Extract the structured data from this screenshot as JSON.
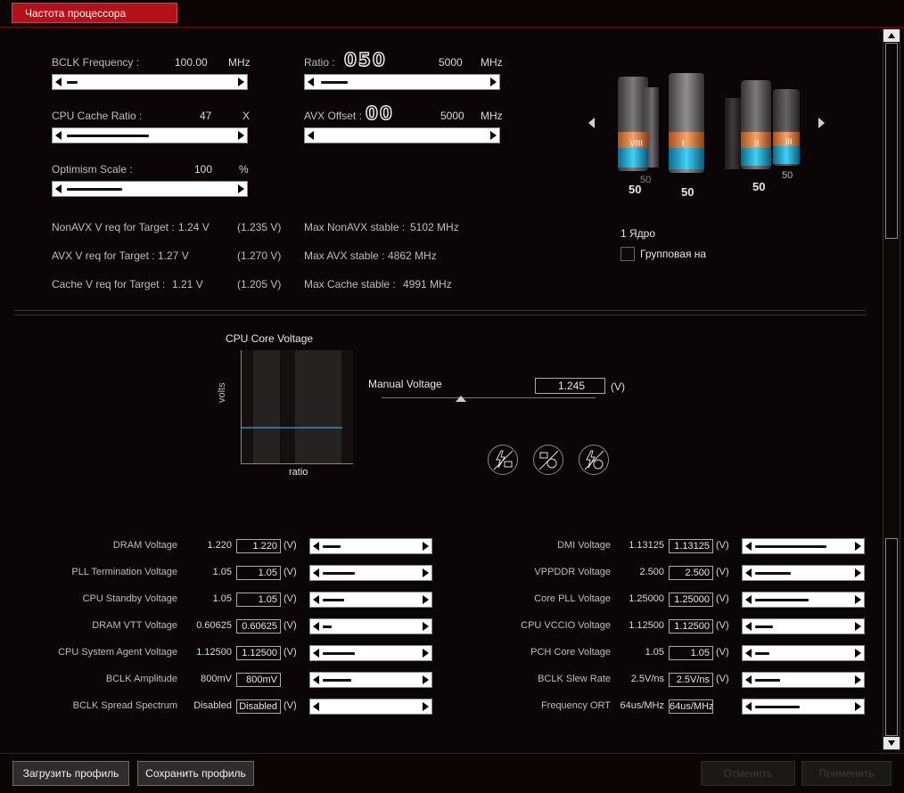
{
  "tab": {
    "label": "Частота процессора"
  },
  "top": {
    "bclk": {
      "label": "BCLK Frequency :",
      "value": "100.00",
      "unit": "MHz"
    },
    "cache_ratio": {
      "label": "CPU Cache Ratio :",
      "value": "47",
      "unit": "X"
    },
    "optimism": {
      "label": "Optimism Scale :",
      "value": "100",
      "unit": "%"
    },
    "ratio": {
      "label": "Ratio :",
      "digits": "050",
      "value": "5000",
      "unit": "MHz"
    },
    "avx_offset": {
      "label": "AVX Offset :",
      "digits": "00",
      "value": "5000",
      "unit": "MHz"
    }
  },
  "targets": [
    {
      "label": "NonAVX V req for Target :",
      "v": "1.24  V",
      "paren": "(1.235  V)",
      "max_label": "Max NonAVX stable :",
      "max_value": "5102  MHz"
    },
    {
      "label": "AVX V req for Target :",
      "v": "1.27  V",
      "paren": "(1.270  V)",
      "max_label": "Max AVX stable :",
      "max_value": "4862  MHz"
    },
    {
      "label": "Cache V req for Target :",
      "v": "1.21  V",
      "paren": "(1.205  V)",
      "max_label": "Max Cache stable :",
      "max_value": "4991  MHz"
    }
  ],
  "cores": {
    "numerals": [
      "VIII",
      "I",
      "II",
      "III"
    ],
    "values": [
      "50",
      "50",
      "50",
      "50",
      "50"
    ],
    "core_label": "1 Ядро",
    "group_label": "Групповая на"
  },
  "voltage": {
    "chart_title": "CPU Core Voltage",
    "y_axis": "volts",
    "x_axis": "ratio",
    "manual_label": "Manual Voltage",
    "manual_value": "1.245",
    "manual_unit": "(V)"
  },
  "mode_icons": [
    "power-save-icon",
    "fan-balance-icon",
    "power-fan-icon"
  ],
  "left_rows": [
    {
      "label": "DRAM Voltage",
      "value": "1.220",
      "input": "1.220",
      "unit": "(V)"
    },
    {
      "label": "PLL Termination Voltage",
      "value": "1.05",
      "input": "1.05",
      "unit": "(V)"
    },
    {
      "label": "CPU Standby Voltage",
      "value": "1.05",
      "input": "1.05",
      "unit": "(V)"
    },
    {
      "label": "DRAM VTT Voltage",
      "value": "0.60625",
      "input": "0.60625",
      "unit": "(V)"
    },
    {
      "label": "CPU System Agent Voltage",
      "value": "1.12500",
      "input": "1.12500",
      "unit": "(V)"
    },
    {
      "label": "BCLK Amplitude",
      "value": "800mV",
      "input": "800mV",
      "unit": ""
    },
    {
      "label": "BCLK Spread Spectrum",
      "value": "Disabled",
      "input": "Disabled",
      "unit": "(V)"
    }
  ],
  "right_rows": [
    {
      "label": "DMI Voltage",
      "value": "1.13125",
      "input": "1.13125",
      "unit": "(V)"
    },
    {
      "label": "VPPDDR Voltage",
      "value": "2.500",
      "input": "2.500",
      "unit": "(V)"
    },
    {
      "label": "Core PLL Voltage",
      "value": "1.25000",
      "input": "1.25000",
      "unit": "(V)"
    },
    {
      "label": "CPU VCCIO Voltage",
      "value": "1.12500",
      "input": "1.12500",
      "unit": "(V)"
    },
    {
      "label": "PCH Core Voltage",
      "value": "1.05",
      "input": "1.05",
      "unit": "(V)"
    },
    {
      "label": "BCLK Slew Rate",
      "value": "2.5V/ns",
      "input": "2.5V/ns",
      "unit": "(V)"
    },
    {
      "label": "Frequency ORT",
      "value": "64us/MHz",
      "input": "64us/MHz",
      "unit": ""
    }
  ],
  "buttons": {
    "load": "Загрузить профиль",
    "save": "Сохранить профиль",
    "cancel": "Отменить",
    "apply": "Применить"
  }
}
